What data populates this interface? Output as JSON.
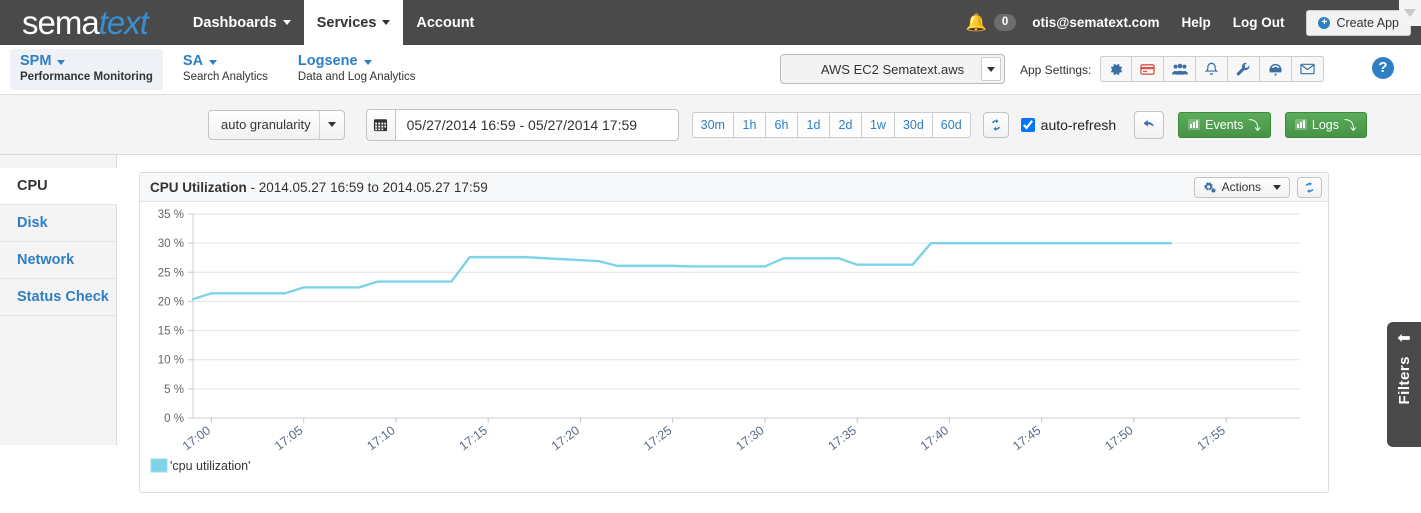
{
  "topnav": {
    "logo_part1": "sema",
    "logo_part2": "text",
    "items": [
      {
        "label": "Dashboards",
        "caret": true,
        "active": false
      },
      {
        "label": "Services",
        "caret": true,
        "active": true
      },
      {
        "label": "Account",
        "caret": false,
        "active": false
      }
    ],
    "bell_icon": "bell-icon",
    "notification_count": "0",
    "user_email": "otis@sematext.com",
    "help_label": "Help",
    "logout_label": "Log Out",
    "create_app_label": "Create App",
    "create_app_icon": "plus-circle-icon",
    "scroll_arrow_icon": "chevron-down-icon",
    "bg_color": "#4a4a4a",
    "logo_accent": "#3a8fd0"
  },
  "appbar": {
    "products": [
      {
        "name": "SPM",
        "sub": "Performance Monitoring",
        "active": true
      },
      {
        "name": "SA",
        "sub": "Search Analytics",
        "active": false
      },
      {
        "name": "Logsene",
        "sub": "Data and Log Analytics",
        "active": false
      }
    ],
    "app_selected": "AWS EC2 Sematext.aws",
    "app_settings_label": "App Settings:",
    "setting_icons": [
      {
        "name": "gear-icon",
        "color": "#3a6ea5"
      },
      {
        "name": "credit-card-icon",
        "color": "#d9534f"
      },
      {
        "name": "users-group-icon",
        "color": "#3a6ea5"
      },
      {
        "name": "bell-icon",
        "color": "#3a6ea5"
      },
      {
        "name": "wrench-icon",
        "color": "#3a6ea5"
      },
      {
        "name": "speedometer-icon",
        "color": "#3a6ea5"
      },
      {
        "name": "envelope-icon",
        "color": "#3a6ea5"
      }
    ],
    "help_icon_label": "?"
  },
  "timebar": {
    "granularity_label": "auto granularity",
    "calendar_icon": "calendar-icon",
    "date_range": "05/27/2014 16:59 - 05/27/2014 17:59",
    "range_buttons": [
      "30m",
      "1h",
      "6h",
      "1d",
      "2d",
      "1w",
      "30d",
      "60d"
    ],
    "refresh_icon": "refresh-icon",
    "auto_refresh_label": "auto-refresh",
    "auto_refresh_checked": true,
    "undo_icon": "undo-arrow-icon",
    "events_label": "Events",
    "logs_label": "Logs",
    "green_color": "#4f9e4f"
  },
  "sidebar": {
    "items": [
      {
        "label": "CPU",
        "active": true
      },
      {
        "label": "Disk",
        "active": false
      },
      {
        "label": "Network",
        "active": false
      },
      {
        "label": "Status Check",
        "active": false
      }
    ]
  },
  "panel": {
    "title_bold": "CPU Utilization",
    "title_rest": " - 2014.05.27 16:59 to 2014.05.27 17:59",
    "actions_label": "Actions",
    "actions_icon": "gears-icon",
    "refresh_icon": "refresh-icon"
  },
  "filters": {
    "label": "Filters",
    "arrow_icon": "arrow-left-icon"
  },
  "chart_data": {
    "type": "line",
    "title": "CPU Utilization - 2014.05.27 16:59 to 2014.05.27 17:59",
    "xlabel": "",
    "ylabel": "",
    "ylim": [
      0,
      35
    ],
    "yticks": [
      "0 %",
      "5 %",
      "10 %",
      "15 %",
      "20 %",
      "25 %",
      "30 %",
      "35 %"
    ],
    "ytick_values": [
      0,
      5,
      10,
      15,
      20,
      25,
      30,
      35
    ],
    "xticks": [
      "17:00",
      "17:05",
      "17:10",
      "17:15",
      "17:20",
      "17:25",
      "17:30",
      "17:35",
      "17:40",
      "17:45",
      "17:50",
      "17:55"
    ],
    "xtick_minutes": [
      0,
      5,
      10,
      15,
      20,
      25,
      30,
      35,
      40,
      45,
      50,
      55
    ],
    "xlim_minutes": [
      -1,
      59
    ],
    "grid": true,
    "legend_position": "bottom-left",
    "line_color": "#7dd3e8",
    "series": [
      {
        "name": "'cpu utilization'",
        "color": "#7dd3e8",
        "x_minutes": [
          -1,
          0,
          1,
          4,
          5,
          8,
          9,
          13,
          14,
          16,
          17,
          21,
          22,
          25,
          26,
          30,
          31,
          34,
          35,
          37,
          38,
          39,
          40,
          52
        ],
        "values": [
          20.4,
          21.4,
          21.4,
          21.4,
          22.4,
          22.4,
          23.4,
          23.4,
          27.6,
          27.6,
          27.6,
          26.9,
          26.1,
          26.1,
          26.0,
          26.0,
          27.4,
          27.4,
          26.3,
          26.3,
          26.3,
          30.0,
          30.0,
          30.0
        ]
      }
    ],
    "legend": [
      {
        "label": "'cpu utilization'",
        "color": "#7dd3e8"
      }
    ]
  }
}
